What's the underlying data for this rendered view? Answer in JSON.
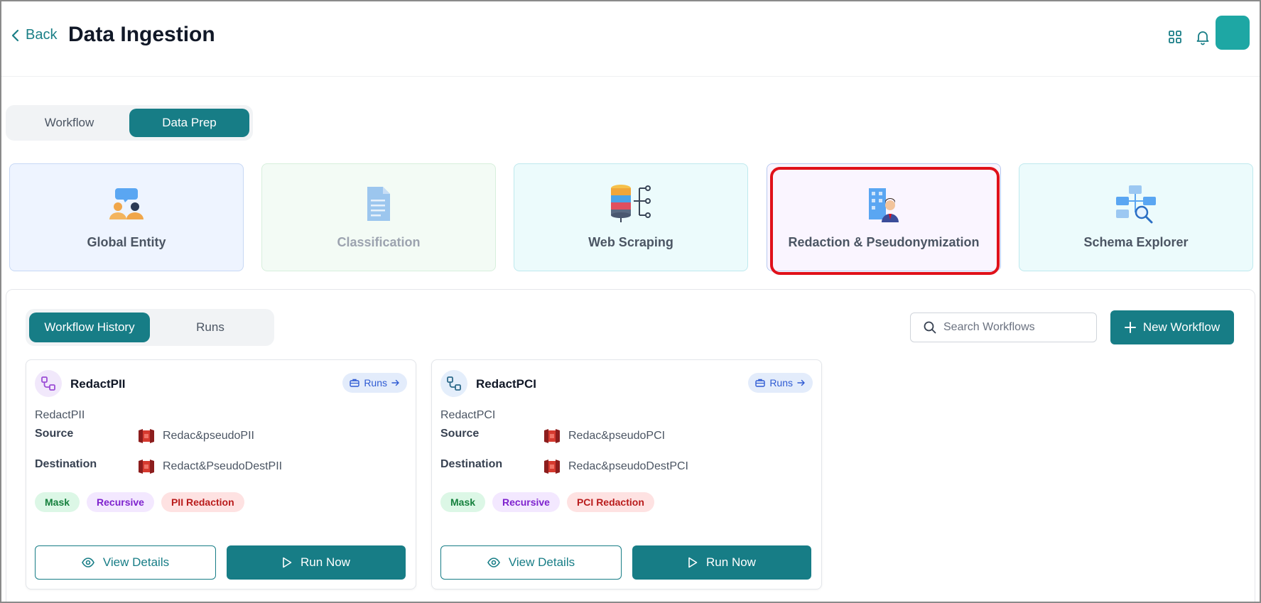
{
  "header": {
    "back_label": "Back",
    "title": "Data Ingestion",
    "icons": [
      "grid-icon",
      "bell-icon"
    ]
  },
  "top_tabs": [
    {
      "label": "Workflow",
      "active": false
    },
    {
      "label": "Data Prep",
      "active": true
    }
  ],
  "categories": [
    {
      "label": "Global Entity",
      "icon": "users-chat-icon"
    },
    {
      "label": "Classification",
      "icon": "document-icon"
    },
    {
      "label": "Web Scraping",
      "icon": "database-network-icon"
    },
    {
      "label": "Redaction & Pseudonymization",
      "icon": "person-building-icon",
      "highlighted": true
    },
    {
      "label": "Schema Explorer",
      "icon": "schema-search-icon"
    }
  ],
  "sub_tabs": [
    {
      "label": "Workflow History",
      "active": true
    },
    {
      "label": "Runs",
      "active": false
    }
  ],
  "search": {
    "placeholder": "Search Workflows"
  },
  "new_workflow_label": "New Workflow",
  "workflows": [
    {
      "title": "RedactPII",
      "runs_label": "Runs",
      "subtitle": "RedactPII",
      "source_label": "Source",
      "source_value": "Redac&pseudoPII",
      "destination_label": "Destination",
      "destination_value": "Redact&PseudoDestPII",
      "tags": [
        "Mask",
        "Recursive",
        "PII Redaction"
      ],
      "view_label": "View Details",
      "run_label": "Run Now"
    },
    {
      "title": "RedactPCI",
      "runs_label": "Runs",
      "subtitle": "RedactPCI",
      "source_label": "Source",
      "source_value": "Redac&pseudoPCI",
      "destination_label": "Destination",
      "destination_value": "Redac&pseudoDestPCI",
      "tags": [
        "Mask",
        "Recursive",
        "PCI Redaction"
      ],
      "view_label": "View Details",
      "run_label": "Run Now"
    }
  ],
  "colors": {
    "accent": "#177d86",
    "highlight": "#e0111a",
    "runs_pill_bg": "#e3ecfb",
    "runs_pill_text": "#2f5bd3"
  }
}
